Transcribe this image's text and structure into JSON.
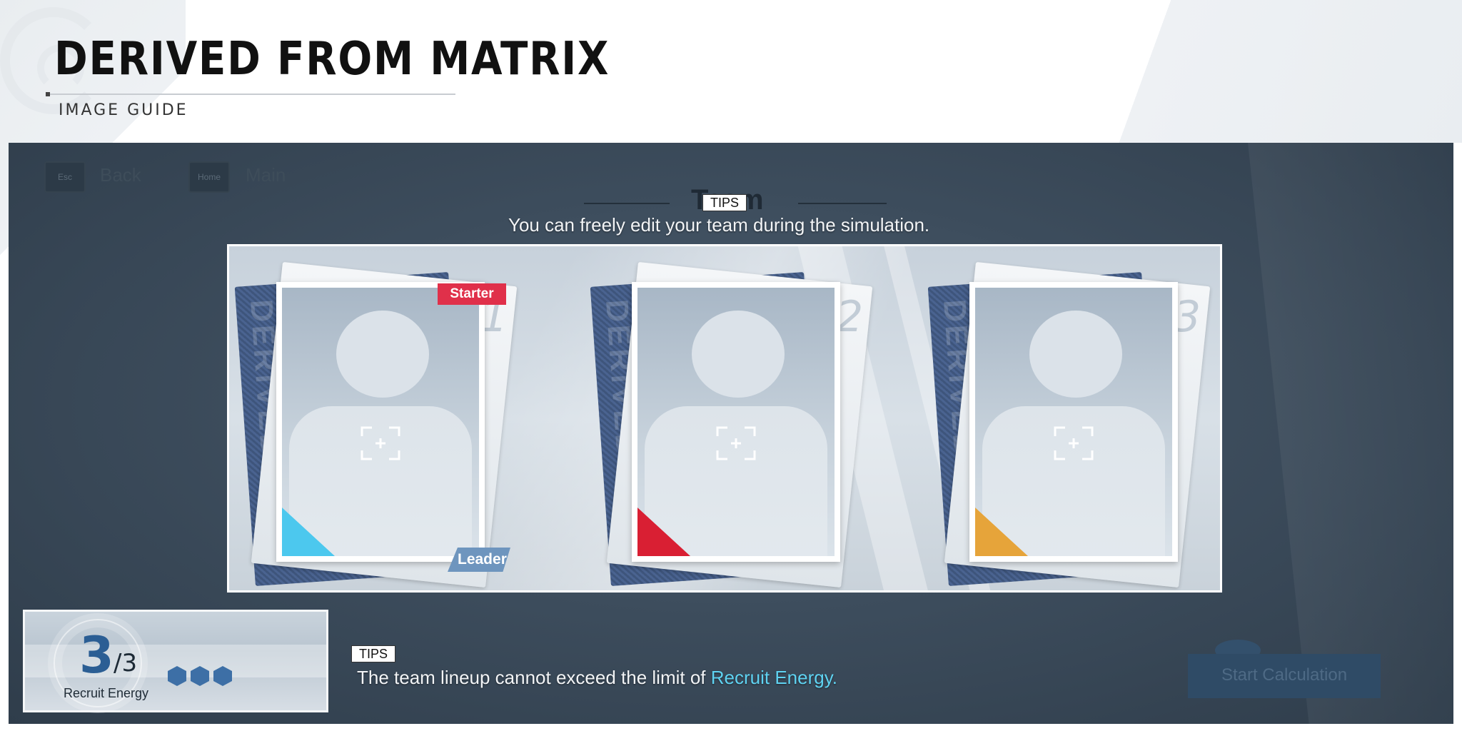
{
  "header": {
    "title": "DERIVED FROM MATRIX",
    "subtitle": "IMAGE GUIDE"
  },
  "top_nav": {
    "back_key": "Esc",
    "back_label": "Back",
    "main_key": "Home",
    "main_label": "Main"
  },
  "screen_title": "Team",
  "tip_top": {
    "tag": "TIPS",
    "text": "You can freely edit your team during the simulation."
  },
  "slots": [
    {
      "number": "1",
      "badge": "Starter",
      "leader_label": "Leader",
      "corner_color": "#4cc8ee"
    },
    {
      "number": "2",
      "corner_color": "#d91f33"
    },
    {
      "number": "3",
      "corner_color": "#e6a43a"
    }
  ],
  "recruit_energy": {
    "current": "3",
    "max": "/3",
    "label": "Recruit Energy",
    "pips": 3
  },
  "tip_bottom": {
    "tag": "TIPS",
    "text_prefix": "The team lineup cannot exceed the limit of ",
    "text_highlight": "Recruit Energy.",
    "highlight_color": "#5fd3f2"
  },
  "start_button": {
    "label": "Start Calculation"
  },
  "icons": {
    "add_member": "add-member-icon",
    "energy_pip": "hexagon-icon"
  }
}
